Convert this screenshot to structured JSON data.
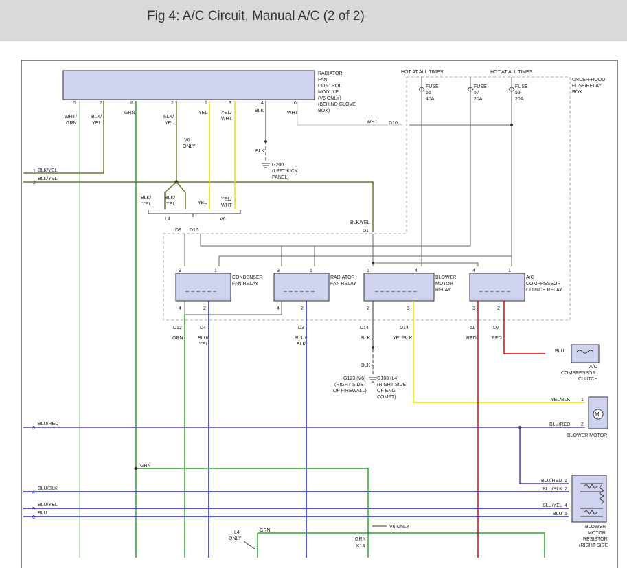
{
  "header": {
    "title": "Fig 4: A/C Circuit, Manual A/C (2 of 2)"
  },
  "colors": {
    "grn": "#2aa52a",
    "yel": "#f0e000",
    "blu": "#2222cc",
    "red": "#e00000",
    "wire_dark": "#777777",
    "olive": "#6b7a2e",
    "purple": "#5a3aa0",
    "module_fill": "#cfd3f0",
    "relay_fill": "#cfd3f0",
    "ltgreen": "#a8d8a0"
  },
  "module": {
    "label_lines": [
      "RADIATOR",
      "FAN",
      "CONTROL",
      "MODULE",
      "(V6 ONLY)",
      "(BEHIND GLOVE",
      "BOX)"
    ],
    "pins": [
      "5",
      "7",
      "8",
      "2",
      "1",
      "3",
      "4",
      "6"
    ],
    "wire_labels": [
      [
        "WHT/",
        "GRN"
      ],
      [
        "BLK/",
        "YEL"
      ],
      [
        "GRN"
      ],
      [
        "BLK/",
        "YEL"
      ],
      [
        "YEL"
      ],
      [
        "YEL/",
        "WHT"
      ],
      [
        "BLK"
      ],
      [
        "WHT"
      ]
    ]
  },
  "fuse_box": {
    "hot1": "HOT AT ALL TIMES",
    "hot2": "HOT AT ALL TIMES",
    "label_lines": [
      "UNDER-HOOD",
      "FUSE/RELAY",
      "BOX"
    ],
    "fuses": [
      {
        "name": "FUSE",
        "num": "56",
        "amp": "40A"
      },
      {
        "name": "FUSE",
        "num": "57",
        "amp": "20A"
      },
      {
        "name": "FUSE",
        "num": "58",
        "amp": "20A"
      }
    ]
  },
  "labels": {
    "wht": "WHT",
    "d10": "D10",
    "blk": "BLK",
    "g200": [
      "G200",
      "(LEFT KICK",
      "PANEL)"
    ],
    "v6_only": [
      "V6",
      "ONLY"
    ],
    "left1": "1",
    "left2": "2",
    "blk_yel": "BLK/YEL",
    "blk_yel2": "BLK/YEL",
    "split_blk": [
      "BLK/",
      "YEL"
    ],
    "split_blk2": [
      "BLK/",
      "YEL"
    ],
    "split_yel": "YEL",
    "split_yelwht": [
      "YEL/",
      "WHT"
    ],
    "l4": "L4",
    "v6": "V6",
    "d8": "D8",
    "d16": "D16",
    "d1": "D1"
  },
  "relays": [
    {
      "label_lines": [
        "CONDENSER",
        "FAN RELAY"
      ],
      "pins_top": [
        "3",
        "1"
      ],
      "pins_bottom": [
        "4",
        "2"
      ]
    },
    {
      "label_lines": [
        "RADIATOR",
        "FAN RELAY"
      ],
      "pins_top": [
        "3",
        "1"
      ],
      "pins_bottom": [
        "4",
        "2"
      ]
    },
    {
      "label_lines": [
        "BLOWER",
        "MOTOR",
        "RELAY"
      ],
      "pins_top": [
        "1",
        "4"
      ],
      "pins_bottom": [
        "2",
        "3"
      ]
    },
    {
      "label_lines": [
        "A/C",
        "COMPRESSOR",
        "CLUTCH RELAY"
      ],
      "pins_top": [
        "4",
        "1"
      ],
      "pins_bottom": [
        "3",
        "2"
      ]
    }
  ],
  "lower": {
    "conn": [
      "D12",
      "D4",
      "D3",
      "D14",
      "D14",
      "11",
      "D7"
    ],
    "wires": [
      [
        "GRN"
      ],
      [
        "BLU/",
        "YEL"
      ],
      [
        "BLU/",
        "BLK"
      ],
      [
        "BLK"
      ],
      [
        "YEL/BLK"
      ],
      [
        "RED"
      ],
      [
        "RED"
      ]
    ],
    "blk": "BLK",
    "g123": [
      "G123 (V6)",
      "(RIGHT SIDE",
      "OF FIREWALL)"
    ],
    "g103": [
      "G103 (L4)",
      "(RIGHT SIDE",
      "OF ENG",
      "COMPT)"
    ]
  },
  "clutch": {
    "wire": "BLU",
    "label_lines": [
      "A/C",
      "COMPRESSOR",
      "CLUTCH"
    ]
  },
  "blower": {
    "wire1": "YEL/BLK",
    "wire2": "BLU/RED",
    "pin1": "1",
    "pin2": "2",
    "label": "BLOWER MOTOR"
  },
  "resistor": {
    "label_lines": [
      "BLOWER",
      "MOTOR",
      "RESISTOR",
      "(RIGHT SIDE"
    ],
    "rows": [
      {
        "wire": "BLU/RED",
        "pin": "1"
      },
      {
        "wire": "BLU/BLK",
        "pin": "2"
      },
      {
        "wire": "BLU/YEL",
        "pin": "4"
      },
      {
        "wire": "BLU",
        "pin": "5"
      }
    ]
  },
  "left_wires": [
    {
      "pin": "3",
      "wire": "BLU/RED"
    },
    {
      "pin": "4",
      "wire": "BLU/BLK"
    },
    {
      "pin": "5",
      "wire": "BLU/YEL"
    },
    {
      "pin": "6",
      "wire": "BLU"
    }
  ],
  "bottom": {
    "grn": "GRN",
    "grn2": "GRN",
    "l4_only": [
      "L4",
      "ONLY"
    ],
    "v6_only": "V6 ONLY",
    "k14": "K14"
  }
}
